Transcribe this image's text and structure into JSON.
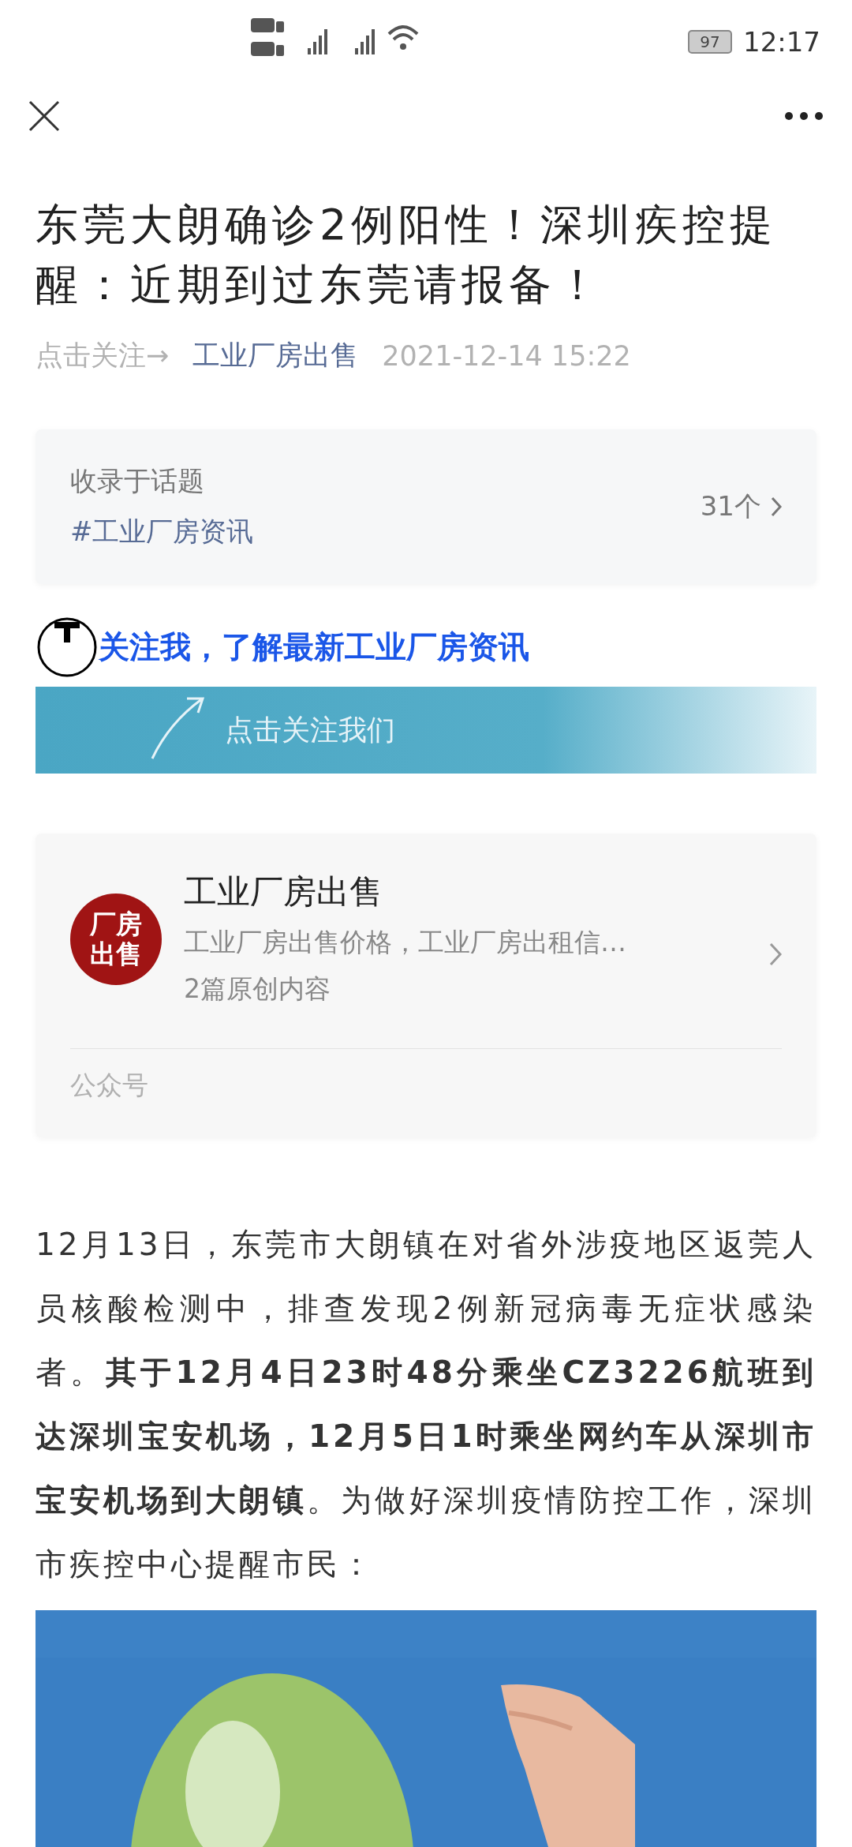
{
  "status_bar": {
    "battery": "97",
    "time": "12:17"
  },
  "article": {
    "title": "东莞大朗确诊2例阳性！深圳疾控提醒：近期到过东莞请报备！",
    "follow_hint": "点击关注→",
    "author": "工业厂房出售",
    "date": "2021-12-14 15:22"
  },
  "topic_card": {
    "label": "收录于话题",
    "topic": "#工业厂房资讯",
    "count": "31个"
  },
  "follow_line": "关注我，了解最新工业厂房资讯",
  "banner": {
    "text": "点击关注我们"
  },
  "account_card": {
    "avatar_text": "厂房出售",
    "name": "工业厂房出售",
    "description": "工业厂房出售价格，工业厂房出租信…",
    "stats": "2篇原创内容",
    "type": "公众号"
  },
  "body": "12月13日，东莞市大朗镇在对省外涉疫地区返莞人员核酸检测中，排查发现2例新冠病毒无症状感染者。**其于12月4日23时48分乘坐CZ3226航班到达深圳宝安机场，12月5日1时乘坐网约车从深圳市宝安机场到大朗镇**。为做好深圳疫情防控工作，深圳市疾控中心提醒市民："
}
